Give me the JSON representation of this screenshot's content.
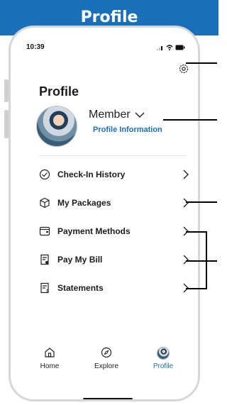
{
  "banner": {
    "title": "Profile"
  },
  "status": {
    "time": "10:39"
  },
  "profile": {
    "heading": "Profile",
    "member_label": "Member",
    "info_link": "Profile Information"
  },
  "menu": [
    {
      "label": "Check-In History",
      "icon": "check-circle-icon"
    },
    {
      "label": "My Packages",
      "icon": "package-icon"
    },
    {
      "label": "Payment Methods",
      "icon": "wallet-icon"
    },
    {
      "label": "Pay My Bill",
      "icon": "bill-icon"
    },
    {
      "label": "Statements",
      "icon": "statement-icon"
    }
  ],
  "tabs": [
    {
      "label": "Home",
      "icon": "home-icon",
      "active": false
    },
    {
      "label": "Explore",
      "icon": "compass-icon",
      "active": false
    },
    {
      "label": "Profile",
      "icon": "profile-avatar-icon",
      "active": true
    }
  ],
  "colors": {
    "brand": "#1a70b8",
    "text": "#1b1b1b"
  }
}
